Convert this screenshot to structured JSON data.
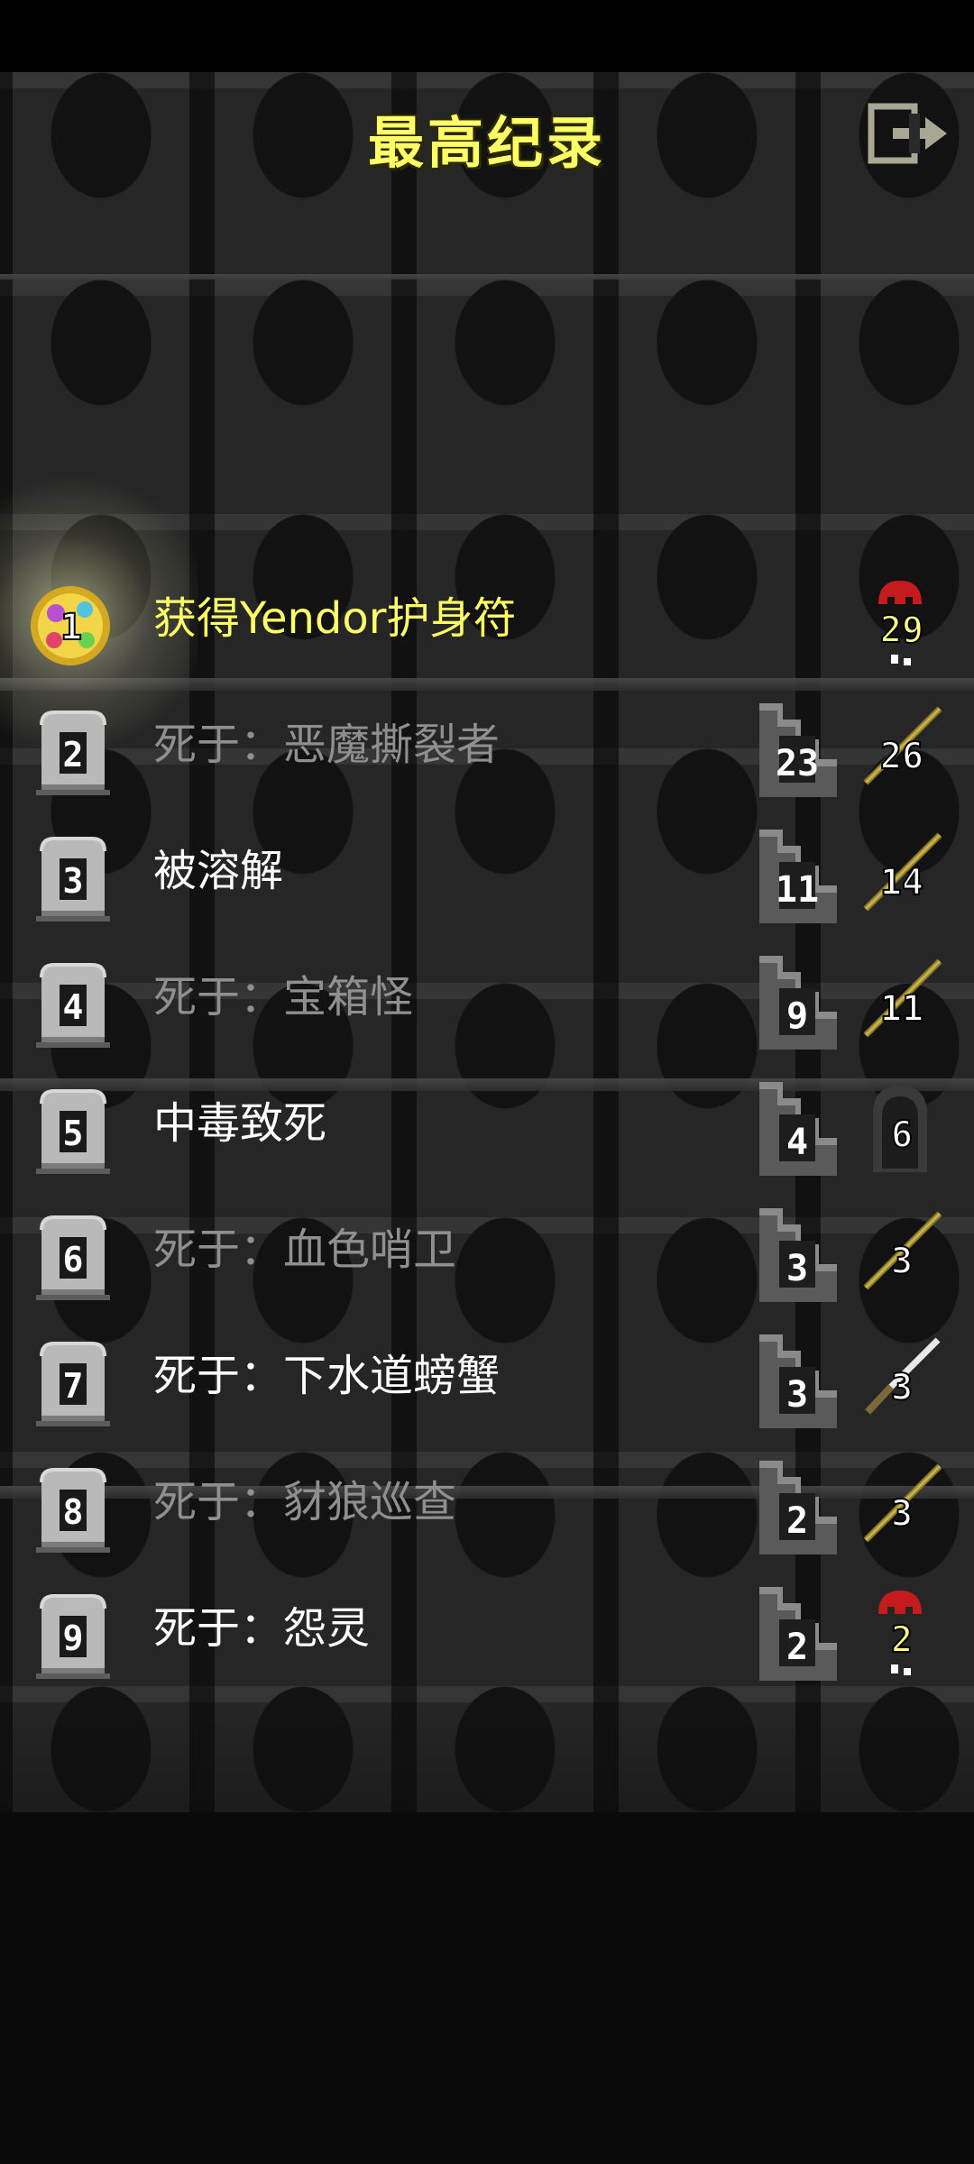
{
  "screen": {
    "title": "最高纪录",
    "exit_icon": "exit-door-icon"
  },
  "records": [
    {
      "rank": "1",
      "cause": "获得Yendor护身符",
      "depth": "",
      "level": "29",
      "rank_icon": "amulet-of-yendor-icon",
      "level_icon": "blood-drop-icon",
      "style": "gold"
    },
    {
      "rank": "2",
      "cause": "死于：恶魔撕裂者",
      "depth": "23",
      "level": "26",
      "rank_icon": "tombstone-icon",
      "level_icon": "sword-icon",
      "style": "dim"
    },
    {
      "rank": "3",
      "cause": "被溶解",
      "depth": "11",
      "level": "14",
      "rank_icon": "tombstone-icon",
      "level_icon": "sword-icon",
      "style": "bright"
    },
    {
      "rank": "4",
      "cause": "死于：宝箱怪",
      "depth": "9",
      "level": "11",
      "rank_icon": "tombstone-icon",
      "level_icon": "sword-icon",
      "style": "dim"
    },
    {
      "rank": "5",
      "cause": "中毒致死",
      "depth": "4",
      "level": "6",
      "rank_icon": "tombstone-icon",
      "level_icon": "hooded-figure-icon",
      "style": "bright"
    },
    {
      "rank": "6",
      "cause": "死于：血色哨卫",
      "depth": "3",
      "level": "3",
      "rank_icon": "tombstone-icon",
      "level_icon": "sword-icon",
      "style": "dim"
    },
    {
      "rank": "7",
      "cause": "死于：下水道螃蟹",
      "depth": "3",
      "level": "3",
      "rank_icon": "tombstone-icon",
      "level_icon": "dagger-icon",
      "style": "bright"
    },
    {
      "rank": "8",
      "cause": "死于：豺狼巡查",
      "depth": "2",
      "level": "3",
      "rank_icon": "tombstone-icon",
      "level_icon": "sword-icon",
      "style": "dim"
    },
    {
      "rank": "9",
      "cause": "死于：怨灵",
      "depth": "2",
      "level": "2",
      "rank_icon": "tombstone-icon",
      "level_icon": "blood-drop-icon",
      "style": "bright"
    }
  ]
}
